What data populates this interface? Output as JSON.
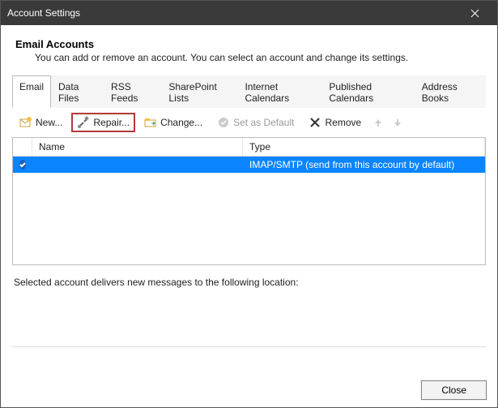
{
  "window": {
    "title": "Account Settings"
  },
  "header": {
    "title": "Email Accounts",
    "description": "You can add or remove an account. You can select an account and change its settings."
  },
  "tabs": [
    {
      "label": "Email",
      "active": true
    },
    {
      "label": "Data Files",
      "active": false
    },
    {
      "label": "RSS Feeds",
      "active": false
    },
    {
      "label": "SharePoint Lists",
      "active": false
    },
    {
      "label": "Internet Calendars",
      "active": false
    },
    {
      "label": "Published Calendars",
      "active": false
    },
    {
      "label": "Address Books",
      "active": false
    }
  ],
  "toolbar": {
    "new_label": "New...",
    "repair_label": "Repair...",
    "change_label": "Change...",
    "set_default_label": "Set as Default",
    "remove_label": "Remove"
  },
  "list": {
    "columns": {
      "name": "Name",
      "type": "Type"
    },
    "rows": [
      {
        "name": "",
        "type": "IMAP/SMTP (send from this account by default)",
        "selected": true,
        "default": true
      }
    ]
  },
  "location_text": "Selected account delivers new messages to the following location:",
  "footer": {
    "close_label": "Close"
  }
}
